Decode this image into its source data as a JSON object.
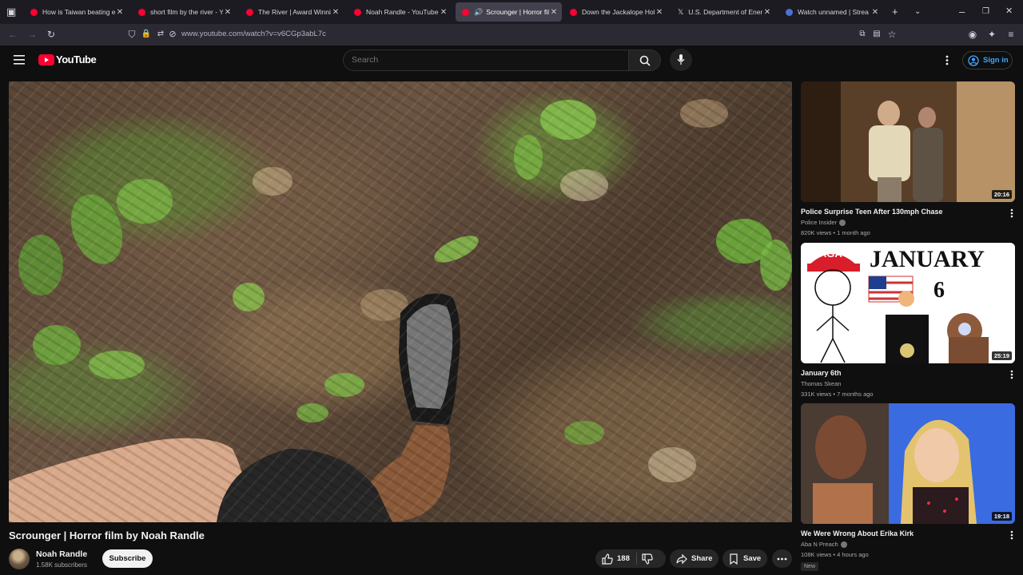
{
  "browser": {
    "tabs": [
      {
        "title": "How is Taiwan beating eve",
        "icon": "youtube-icon"
      },
      {
        "title": "short film by the river - You",
        "icon": "youtube-icon"
      },
      {
        "title": "The River | Award Winning",
        "icon": "youtube-icon"
      },
      {
        "title": "Noah Randle - YouTube",
        "icon": "youtube-icon"
      },
      {
        "title": "Scrounger | Horror film",
        "icon": "youtube-icon",
        "active": true
      },
      {
        "title": "Down the Jackalope Hole |",
        "icon": "youtube-icon"
      },
      {
        "title": "U.S. Department of Energy",
        "icon": "x-icon"
      },
      {
        "title": "Watch unnamed | Strea",
        "icon": "go-icon"
      }
    ],
    "url": "www.youtube.com/watch?v=v6CGp3abL7c"
  },
  "masthead": {
    "logo_text": "YouTube",
    "search_placeholder": "Search",
    "signin_label": "Sign in"
  },
  "video": {
    "title": "Scrounger | Horror film by Noah Randle",
    "channel": "Noah Randle",
    "subscribers": "1.58K subscribers",
    "subscribe_label": "Subscribe",
    "likes": "188",
    "share_label": "Share",
    "save_label": "Save"
  },
  "recommendations": [
    {
      "title": "Police Surprise Teen After 130mph Chase",
      "channel": "Police Insider",
      "verified": true,
      "meta": "820K views • 1 month ago",
      "duration": "20:16"
    },
    {
      "title": "January 6th",
      "channel": "Thomas Skean",
      "verified": false,
      "meta": "331K views • 7 months ago",
      "duration": "25:19",
      "thumb_text_left": "MAGA",
      "thumb_text_right": "JANUARY",
      "thumb_number": "6"
    },
    {
      "title": "We Were Wrong About Erika Kirk",
      "channel": "Aba N Preach",
      "verified": true,
      "meta": "108K views • 4 hours ago",
      "duration": "19:18",
      "badge": "New"
    }
  ],
  "colors": {
    "background": "#0f0f0f",
    "brand_red": "#ff0033",
    "link_blue": "#3ea6ff",
    "tab_strip": "#1c1b22",
    "toolbar": "#2b2a33"
  }
}
